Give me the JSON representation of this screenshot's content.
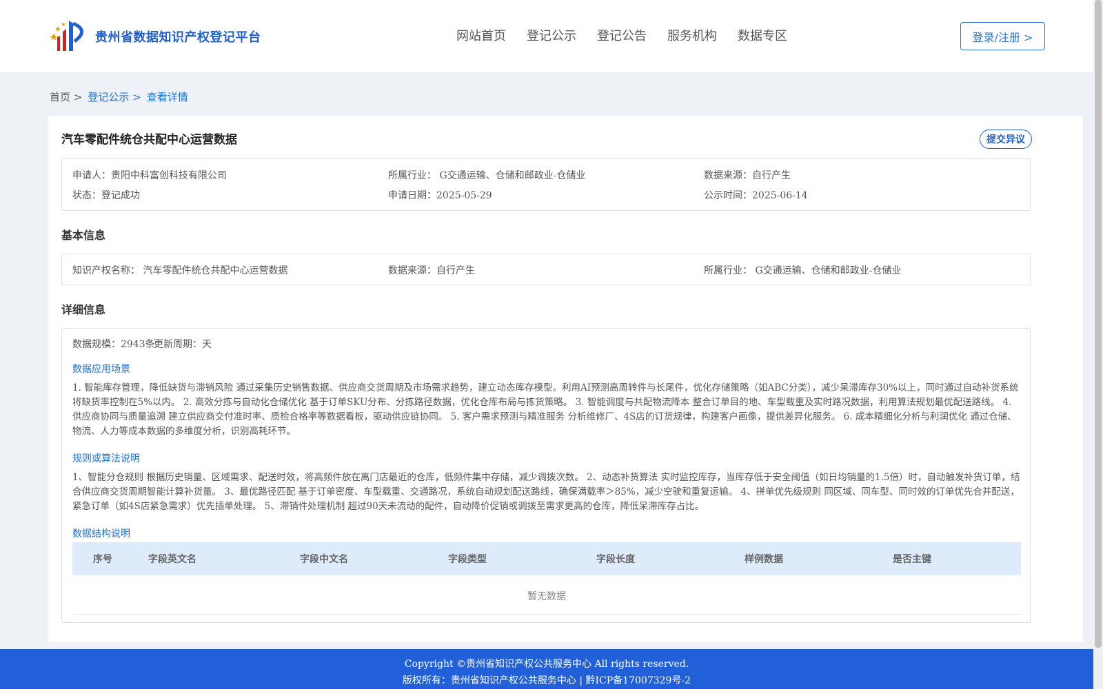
{
  "header": {
    "logo_text": "贵州省数据知识产权登记平台",
    "nav": [
      "网站首页",
      "登记公示",
      "登记公告",
      "服务机构",
      "数据专区"
    ],
    "login_label": "登录/注册 >"
  },
  "breadcrumb": {
    "home": "首页 >",
    "level2": "登记公示 >",
    "current": "查看详情"
  },
  "detail": {
    "title": "汽车零配件统仓共配中心运营数据",
    "objection_label": "提交异议",
    "summary": {
      "applicant": "申请人：贵阳中科富创科技有限公司",
      "industry": "所属行业： G交通运输、仓储和邮政业-仓储业",
      "source": "数据来源：自行产生",
      "status": "状态：登记成功",
      "apply_date": "申请日期：2025-05-29",
      "publish_time": "公示时间：2025-06-14"
    },
    "basic_title": "基本信息",
    "basic": {
      "ip_name": "知识产权名称： 汽车零配件统仓共配中心运营数据",
      "source": "数据来源：自行产生",
      "industry": "所属行业： G交通运输、仓储和邮政业-仓储业"
    },
    "detail_title": "详细信息",
    "scale": "数据规模：2943条",
    "cycle": "更新周期：天",
    "scenario_title": "数据应用场景",
    "scenario_text": "1. 智能库存管理，降低缺货与滞销风险 通过采集历史销售数据、供应商交货周期及市场需求趋势，建立动态库存模型。利用AI预测高周转件与长尾件，优化存储策略（如ABC分类），减少呆滞库存30%以上，同时通过自动补货系统将缺货率控制在5%以内。 2. 高效分拣与自动化仓储优化 基于订单SKU分布、分拣路径数据，优化仓库布局与拣货策略。 3. 智能调度与共配物流降本 整合订单目的地、车型载重及实时路况数据，利用算法规划最优配送路线。 4. 供应商协同与质量追溯 建立供应商交付准时率、质检合格率等数据看板，驱动供应链协同。 5. 客户需求预测与精准服务 分析维修厂、4S店的订货规律，构建客户画像，提供差异化服务。 6. 成本精细化分析与利润优化 通过仓储、物流、人力等成本数据的多维度分析，识别高耗环节。",
    "rule_title": "规则或算法说明",
    "rule_text": "1、智能分仓规则 根据历史销量、区域需求、配送时效，将高频件放在离门店最近的仓库，低频件集中存储，减少调拨次数。 2、动态补货算法 实时监控库存，当库存低于安全阈值（如日均销量的1.5倍）时，自动触发补货订单，结合供应商交货周期智能计算补货量。 3、最优路径匹配 基于订单密度、车型载重、交通路况，系统自动规划配送路线，确保满载率＞85%，减少空驶和重复运输。 4、拼单优先级规则 同区域、同车型、同时效的订单优先合并配送，紧急订单（如4S店紧急需求）优先插单处理。 5、滞销件处理机制 超过90天未流动的配件，自动降价促销或调拨至需求更高的仓库，降低呆滞库存占比。",
    "structure_title": "数据结构说明",
    "table_headers": [
      "序号",
      "字段英文名",
      "字段中文名",
      "字段类型",
      "字段长度",
      "样例数据",
      "是否主键"
    ],
    "empty_text": "暂无数据"
  },
  "footer": {
    "line1": "Copyright ©贵州省知识产权公共服务中心 All rights reserved.",
    "line2": "版权所有：贵州省知识产权公共服务中心 | 黔ICP备17007329号-2"
  },
  "colors": {
    "brand": "#1f5fcf",
    "link": "#1f6fd6",
    "footer_bg": "#2160d8",
    "table_head_bg": "#deebfa"
  }
}
